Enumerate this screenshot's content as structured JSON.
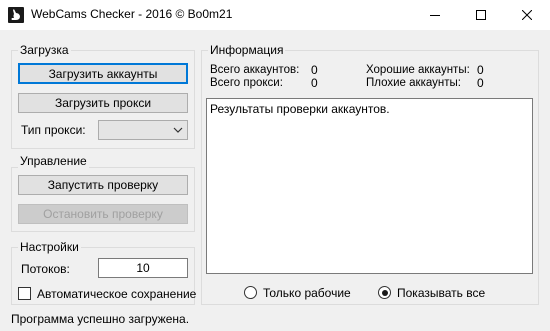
{
  "window": {
    "title": "WebCams Checker - 2016 © Bo0m21"
  },
  "load_group": {
    "label": "Загрузка",
    "load_accounts_button": "Загрузить аккаунты",
    "load_proxy_button": "Загрузить прокси",
    "proxy_type_label": "Тип прокси:",
    "proxy_type_value": ""
  },
  "control_group": {
    "label": "Управление",
    "start_button": "Запустить проверку",
    "stop_button": "Остановить проверку"
  },
  "settings_group": {
    "label": "Настройки",
    "threads_label": "Потоков:",
    "threads_value": "10",
    "autosave_label": "Автоматическое сохранение",
    "autosave_checked": false
  },
  "info_group": {
    "label": "Информация",
    "total_accounts_label": "Всего аккаунтов:",
    "total_accounts_value": "0",
    "total_proxy_label": "Всего прокси:",
    "total_proxy_value": "0",
    "good_accounts_label": "Хорошие аккаунты:",
    "good_accounts_value": "0",
    "bad_accounts_label": "Плохие аккаунты:",
    "bad_accounts_value": "0",
    "results_text": "Результаты проверки аккаунтов.",
    "filter_working_label": "Только рабочие",
    "filter_all_label": "Показывать все",
    "selected_filter": "all"
  },
  "status_bar": {
    "text": "Программа успешно загружена."
  },
  "icons": {
    "app": "rabbit-icon",
    "minimize": "minimize-icon",
    "maximize": "maximize-icon",
    "close": "close-icon"
  }
}
